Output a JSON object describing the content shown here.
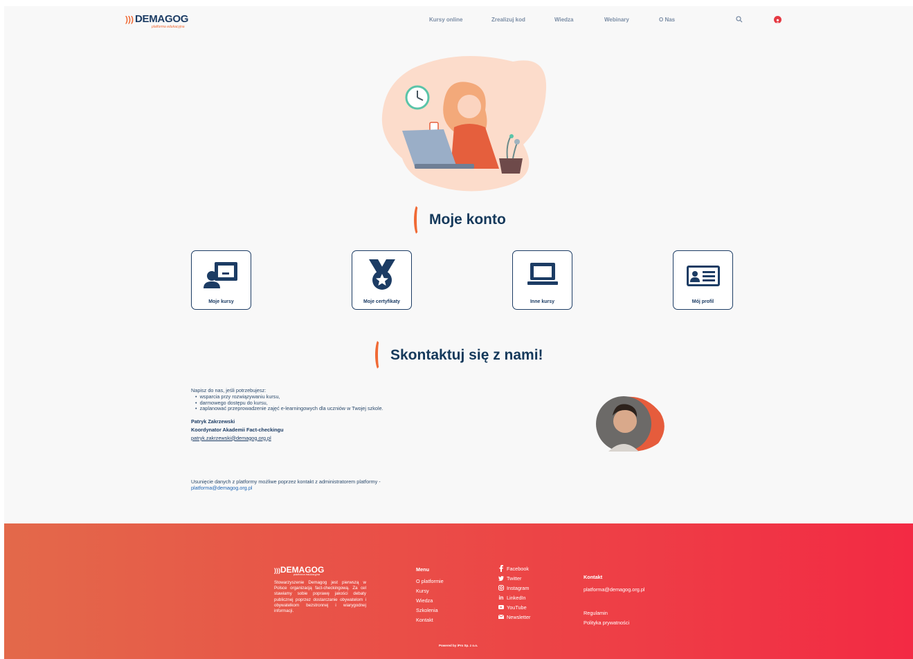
{
  "header": {
    "logo": "DEMAGOG",
    "logo_tagline": "platforma edukacyjna",
    "nav": [
      "Kursy online",
      "Zrealizuj kod",
      "Wiedza",
      "Webinary",
      "O Nas"
    ]
  },
  "account": {
    "title": "Moje konto",
    "cards": [
      "Moje kursy",
      "Moje certyfikaty",
      "Inne kursy",
      "Mój profil"
    ]
  },
  "contact": {
    "title": "Skontaktuj się z nami!",
    "intro": "Napisz do nas, jeśli potrzebujesz:",
    "needs": [
      "wsparcia przy rozwiązywaniu kursu,",
      "darmowego dostępu do kursu,",
      "zaplanować przeprowadzenie zajęć e-learningowych dla uczniów w Twojej szkole."
    ],
    "person_name": "Patryk Zakrzewski",
    "person_role": "Koordynator Akademii Fact-checkingu",
    "person_email": "patryk.zakrzewski@demagog.org.pl",
    "removal_text": "Usunięcie danych z platformy możliwe poprzez kontakt z administratorem platformy -",
    "removal_email": "platforma@demagog.org.pl"
  },
  "footer": {
    "logo": "DEMAGOG",
    "logo_tagline": "platforma edukacyjna",
    "about": "Stowarzyszenie Demagog jest pierwszą w Polsce organizacją fact-checkingową. Za cel stawiamy sobie poprawę jakości debaty publicznej poprzez dostarczanie obywatelom i obywatelkom bezstronnej i wiarygodnej informacji.",
    "menu_title": "Menu",
    "menu": [
      "O platformie",
      "Kursy",
      "Wiedza",
      "Szkolenia",
      "Kontakt"
    ],
    "social": [
      "Facebook",
      "Twitter",
      "Instagram",
      "LinkedIn",
      "YouTube",
      "Newsletter"
    ],
    "contact_title": "Kontakt",
    "contact_email": "platforma@demagog.org.pl",
    "terms": "Regulamin",
    "privacy": "Polityka prywatności",
    "powered": "Powered by iPro Sp. z o.o."
  },
  "colors": {
    "accent": "#f06a35",
    "navy": "#1c3c64",
    "footer_start": "#e3694a",
    "footer_end": "#f32a44"
  }
}
